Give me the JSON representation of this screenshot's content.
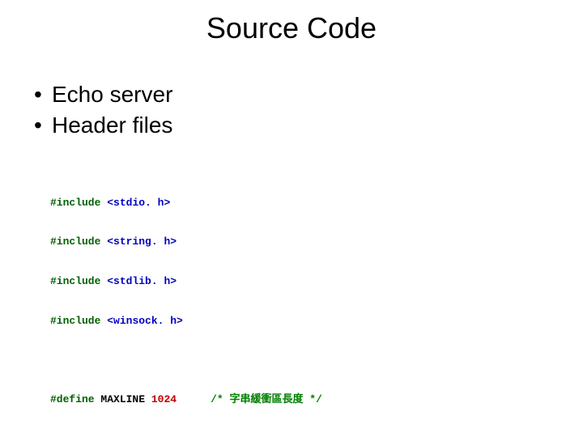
{
  "title": "Source Code",
  "bullets": [
    "Echo server",
    "Header files"
  ],
  "code": {
    "includes": [
      {
        "directive": "#include",
        "header": "<stdio. h>"
      },
      {
        "directive": "#include",
        "header": "<string. h>"
      },
      {
        "directive": "#include",
        "header": "<stdlib. h>"
      },
      {
        "directive": "#include",
        "header": "<winsock. h>"
      }
    ],
    "define": {
      "directive": "#define",
      "name": "MAXLINE",
      "value": "1024",
      "comment": "/* 字串緩衝區長度 */"
    }
  }
}
